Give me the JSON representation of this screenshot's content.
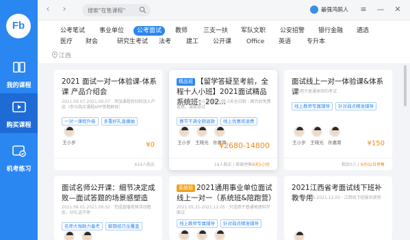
{
  "sidebar": {
    "logo": "Fb",
    "items": [
      {
        "label": "我的课程",
        "icon": "book-icon"
      },
      {
        "label": "购买课程",
        "icon": "video-play-icon"
      },
      {
        "label": "机考练习",
        "icon": "exam-icon"
      }
    ]
  },
  "titlebar": {
    "search_placeholder": "搜索\"在售课程\"",
    "user_name": "最强鸿鹄人"
  },
  "categories": {
    "row1": [
      "公考笔试",
      "事业单位",
      "公考面试",
      "教师",
      "三支一扶",
      "军队文职",
      "公安招警",
      "银行金融",
      "遴选"
    ],
    "row2": [
      "医疗",
      "财会",
      "研究生考试",
      "法考",
      "建工",
      "公开课",
      "Office",
      "英语",
      "专升本"
    ],
    "active": "公考面试",
    "location": "江西"
  },
  "cards": [
    {
      "title": "2021 面试一对一体验课-体系课 产品介绍会",
      "sub": "2021.09.07-2021.09.07 · 添加课程后扫码加入产品（参与购买课程APP答题群体）",
      "tags": [
        "一对一课程升级",
        "多重好礼直播抽"
      ],
      "teachers": [
        "王小岁"
      ],
      "price": "¥0",
      "foot_left": "",
      "foot_right": "614人购买"
    },
    {
      "badge": "精品班",
      "title": "【留学答疑至考前，全程十人小班】2021面试精品系统班：202...",
      "sub": "全日制班-8.8-5天每天小班-3天全日制 - 面完后免费退费，课面测试",
      "tags": [
        "赛节不满全额退款",
        "线上优惠班退费"
      ],
      "teachers": [
        "王小岁",
        "王晓光",
        "孙嘉南"
      ],
      "price": "¥2680-14800",
      "foot_right": "19人购买 | 距离停售",
      "foot_hl": "8天5小时"
    },
    {
      "title": "面试线上一对一体验课&体系课",
      "sub": "只适用于普通体验的考试",
      "tags": [
        "线上教师专属辅导",
        "针对弱点精准辅导"
      ],
      "teachers": [
        "王小岁",
        "王晓光",
        "孙嘉南"
      ],
      "price": "¥150",
      "foot_right": "剩余0人 | ",
      "foot_hl": "9月02日停售"
    },
    {
      "title": "面试名师公开课：细节决定成败—面试答题的场景感塑造",
      "sub": "2021.08.01-2021.09.02 · 完成直播视频活动题库，好礼送不停",
      "tags": [
        "名师大咖助力备考",
        "解题技巧全覆盖"
      ],
      "teachers": [],
      "price": ""
    },
    {
      "badge": "系统班",
      "title": "2021通用事业单位面试线上一对一（系统班&陪跑营）",
      "sub": "2021.05.31-2021.12.05 · 只适用于普通地理科学面试",
      "tags": [
        "线上教师专属辅导",
        "针对弱点精准辅导"
      ],
      "teachers": [],
      "price": ""
    },
    {
      "title": "2021江西省考面试线下班补教专用",
      "sub": "2021.08.05-2021.12.03 · 江西线下班报名使用",
      "tags": [],
      "teachers": [],
      "price": ""
    }
  ],
  "colors": {
    "primary": "#2a86f0",
    "price": "#f08a1c"
  }
}
